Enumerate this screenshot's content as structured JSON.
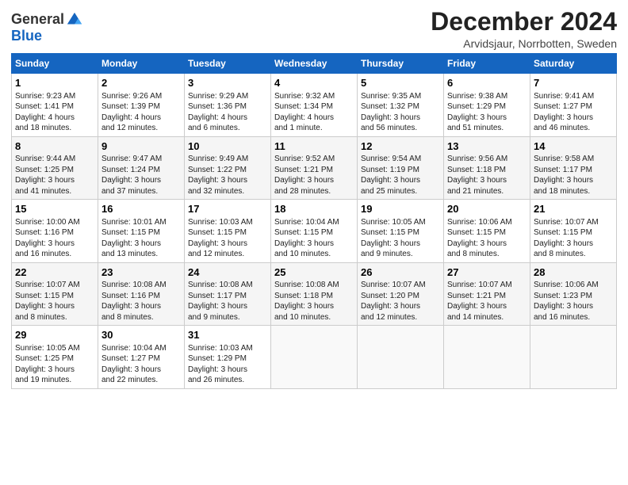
{
  "header": {
    "logo_general": "General",
    "logo_blue": "Blue",
    "title": "December 2024",
    "subtitle": "Arvidsjaur, Norrbotten, Sweden"
  },
  "weekdays": [
    "Sunday",
    "Monday",
    "Tuesday",
    "Wednesday",
    "Thursday",
    "Friday",
    "Saturday"
  ],
  "weeks": [
    [
      {
        "day": "1",
        "info": "Sunrise: 9:23 AM\nSunset: 1:41 PM\nDaylight: 4 hours\nand 18 minutes."
      },
      {
        "day": "2",
        "info": "Sunrise: 9:26 AM\nSunset: 1:39 PM\nDaylight: 4 hours\nand 12 minutes."
      },
      {
        "day": "3",
        "info": "Sunrise: 9:29 AM\nSunset: 1:36 PM\nDaylight: 4 hours\nand 6 minutes."
      },
      {
        "day": "4",
        "info": "Sunrise: 9:32 AM\nSunset: 1:34 PM\nDaylight: 4 hours\nand 1 minute."
      },
      {
        "day": "5",
        "info": "Sunrise: 9:35 AM\nSunset: 1:32 PM\nDaylight: 3 hours\nand 56 minutes."
      },
      {
        "day": "6",
        "info": "Sunrise: 9:38 AM\nSunset: 1:29 PM\nDaylight: 3 hours\nand 51 minutes."
      },
      {
        "day": "7",
        "info": "Sunrise: 9:41 AM\nSunset: 1:27 PM\nDaylight: 3 hours\nand 46 minutes."
      }
    ],
    [
      {
        "day": "8",
        "info": "Sunrise: 9:44 AM\nSunset: 1:25 PM\nDaylight: 3 hours\nand 41 minutes."
      },
      {
        "day": "9",
        "info": "Sunrise: 9:47 AM\nSunset: 1:24 PM\nDaylight: 3 hours\nand 37 minutes."
      },
      {
        "day": "10",
        "info": "Sunrise: 9:49 AM\nSunset: 1:22 PM\nDaylight: 3 hours\nand 32 minutes."
      },
      {
        "day": "11",
        "info": "Sunrise: 9:52 AM\nSunset: 1:21 PM\nDaylight: 3 hours\nand 28 minutes."
      },
      {
        "day": "12",
        "info": "Sunrise: 9:54 AM\nSunset: 1:19 PM\nDaylight: 3 hours\nand 25 minutes."
      },
      {
        "day": "13",
        "info": "Sunrise: 9:56 AM\nSunset: 1:18 PM\nDaylight: 3 hours\nand 21 minutes."
      },
      {
        "day": "14",
        "info": "Sunrise: 9:58 AM\nSunset: 1:17 PM\nDaylight: 3 hours\nand 18 minutes."
      }
    ],
    [
      {
        "day": "15",
        "info": "Sunrise: 10:00 AM\nSunset: 1:16 PM\nDaylight: 3 hours\nand 16 minutes."
      },
      {
        "day": "16",
        "info": "Sunrise: 10:01 AM\nSunset: 1:15 PM\nDaylight: 3 hours\nand 13 minutes."
      },
      {
        "day": "17",
        "info": "Sunrise: 10:03 AM\nSunset: 1:15 PM\nDaylight: 3 hours\nand 12 minutes."
      },
      {
        "day": "18",
        "info": "Sunrise: 10:04 AM\nSunset: 1:15 PM\nDaylight: 3 hours\nand 10 minutes."
      },
      {
        "day": "19",
        "info": "Sunrise: 10:05 AM\nSunset: 1:15 PM\nDaylight: 3 hours\nand 9 minutes."
      },
      {
        "day": "20",
        "info": "Sunrise: 10:06 AM\nSunset: 1:15 PM\nDaylight: 3 hours\nand 8 minutes."
      },
      {
        "day": "21",
        "info": "Sunrise: 10:07 AM\nSunset: 1:15 PM\nDaylight: 3 hours\nand 8 minutes."
      }
    ],
    [
      {
        "day": "22",
        "info": "Sunrise: 10:07 AM\nSunset: 1:15 PM\nDaylight: 3 hours\nand 8 minutes."
      },
      {
        "day": "23",
        "info": "Sunrise: 10:08 AM\nSunset: 1:16 PM\nDaylight: 3 hours\nand 8 minutes."
      },
      {
        "day": "24",
        "info": "Sunrise: 10:08 AM\nSunset: 1:17 PM\nDaylight: 3 hours\nand 9 minutes."
      },
      {
        "day": "25",
        "info": "Sunrise: 10:08 AM\nSunset: 1:18 PM\nDaylight: 3 hours\nand 10 minutes."
      },
      {
        "day": "26",
        "info": "Sunrise: 10:07 AM\nSunset: 1:20 PM\nDaylight: 3 hours\nand 12 minutes."
      },
      {
        "day": "27",
        "info": "Sunrise: 10:07 AM\nSunset: 1:21 PM\nDaylight: 3 hours\nand 14 minutes."
      },
      {
        "day": "28",
        "info": "Sunrise: 10:06 AM\nSunset: 1:23 PM\nDaylight: 3 hours\nand 16 minutes."
      }
    ],
    [
      {
        "day": "29",
        "info": "Sunrise: 10:05 AM\nSunset: 1:25 PM\nDaylight: 3 hours\nand 19 minutes."
      },
      {
        "day": "30",
        "info": "Sunrise: 10:04 AM\nSunset: 1:27 PM\nDaylight: 3 hours\nand 22 minutes."
      },
      {
        "day": "31",
        "info": "Sunrise: 10:03 AM\nSunset: 1:29 PM\nDaylight: 3 hours\nand 26 minutes."
      },
      null,
      null,
      null,
      null
    ]
  ]
}
